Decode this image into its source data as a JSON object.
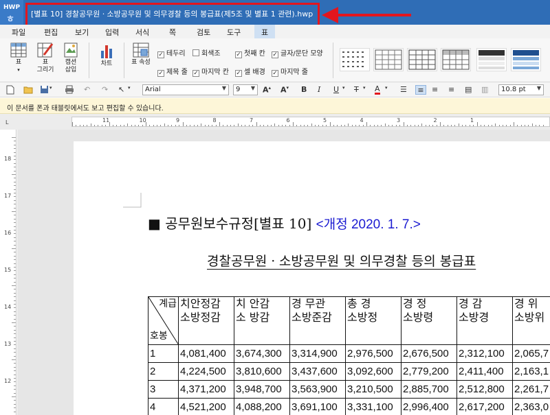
{
  "window": {
    "app_badge": "HWP",
    "app_glyph": "ㅎ",
    "title": "[별표 10] 경찰공무원ㆍ소방공무원 및 의무경찰 등의 봉급표(제5조 및 별표 1 관련).hwp"
  },
  "menu": [
    "파일",
    "편집",
    "보기",
    "입력",
    "서식",
    "쪽",
    "검토",
    "도구",
    "표"
  ],
  "ribbon": {
    "table_btn": "표",
    "draw_table_btn_1": "표",
    "draw_table_btn_2": "그리기",
    "caption_btn_1": "캡션",
    "caption_btn_2": "삽입",
    "chart_btn": "차트",
    "table_props_btn": "표 속성",
    "checks": [
      {
        "label": "테두리",
        "checked": true
      },
      {
        "label": "회색조",
        "checked": false
      },
      {
        "label": "첫째 칸",
        "checked": true
      },
      {
        "label": "글자/문단 모양",
        "checked": true
      },
      {
        "label": "제목 줄",
        "checked": true
      },
      {
        "label": "마지막 칸",
        "checked": true
      },
      {
        "label": "셀 배경",
        "checked": true
      },
      {
        "label": "마지막 줄",
        "checked": true
      }
    ]
  },
  "toolbar": {
    "font": "Arial",
    "size": "9",
    "line_spacing": "10.8 pt"
  },
  "notice": "이 문서를 폰과 태블릿에서도 보고 편집할 수 있습니다.",
  "ruler": {
    "h_numbers": [
      "11",
      "10",
      "9",
      "8",
      "7",
      "6",
      "5",
      "4",
      "3",
      "2",
      "1"
    ],
    "v_numbers": [
      "18",
      "17",
      "16",
      "15",
      "14",
      "13",
      "12"
    ]
  },
  "document": {
    "heading_marker": "■",
    "heading": "공무원보수규정[별표 10]",
    "amendment": "<개정 2020. 1. 7.>",
    "subtitle": "경찰공무원ㆍ소방공무원 및 의무경찰 등의 봉급표",
    "table": {
      "corner_top": "계급",
      "corner_bottom": "호봉",
      "headers": [
        [
          "치안정감",
          "소방정감"
        ],
        [
          "치 안감",
          "소 방감"
        ],
        [
          "경 무관",
          "소방준감"
        ],
        [
          "총 경",
          "소방정"
        ],
        [
          "경 정",
          "소방령"
        ],
        [
          "경 감",
          "소방경"
        ],
        [
          "경 위",
          "소방위"
        ]
      ],
      "rows": [
        [
          "1",
          "4,081,400",
          "3,674,300",
          "3,314,900",
          "2,976,500",
          "2,676,500",
          "2,312,100",
          "2,065,7"
        ],
        [
          "2",
          "4,224,500",
          "3,810,600",
          "3,437,600",
          "3,092,600",
          "2,779,200",
          "2,411,400",
          "2,163,1"
        ],
        [
          "3",
          "4,371,200",
          "3,948,700",
          "3,563,900",
          "3,210,500",
          "2,885,700",
          "2,512,800",
          "2,261,7"
        ],
        [
          "4",
          "4,521,200",
          "4,088,200",
          "3,691,100",
          "3,331,100",
          "2,996,400",
          "2,617,200",
          "2,363,0"
        ]
      ]
    }
  }
}
